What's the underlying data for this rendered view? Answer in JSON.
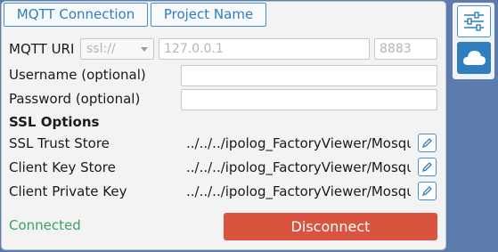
{
  "tabs": {
    "mqtt_connection": "MQTT Connection",
    "project_name": "Project Name"
  },
  "form": {
    "mqtt_uri": {
      "label": "MQTT URI",
      "scheme_placeholder": "ssl://",
      "host_placeholder": "127.0.0.1",
      "port_placeholder": "8883"
    },
    "username": {
      "label": "Username (optional)",
      "value": ""
    },
    "password": {
      "label": "Password (optional)",
      "value": ""
    },
    "ssl_heading": "SSL Options",
    "ssl_trust_store": {
      "label": "SSL Trust Store",
      "path": "../../../ipolog_FactoryViewer/Mosquitto/certs/ca.crt"
    },
    "client_key_store": {
      "label": "Client Key Store",
      "path": "../../../ipolog_FactoryViewer/Mosquitto/certs/client.crt"
    },
    "client_private_key": {
      "label": "Client Private Key",
      "path": "../../../ipolog_FactoryViewer/Mosquitto/certs/client.key"
    }
  },
  "status": {
    "text": "Connected",
    "color": "#3aa06a"
  },
  "actions": {
    "disconnect_label": "Disconnect",
    "disconnect_color": "#d9533f"
  },
  "sidebar": {
    "buttons": [
      {
        "icon": "settings-sliders-icon"
      },
      {
        "icon": "cloud-icon"
      }
    ]
  }
}
